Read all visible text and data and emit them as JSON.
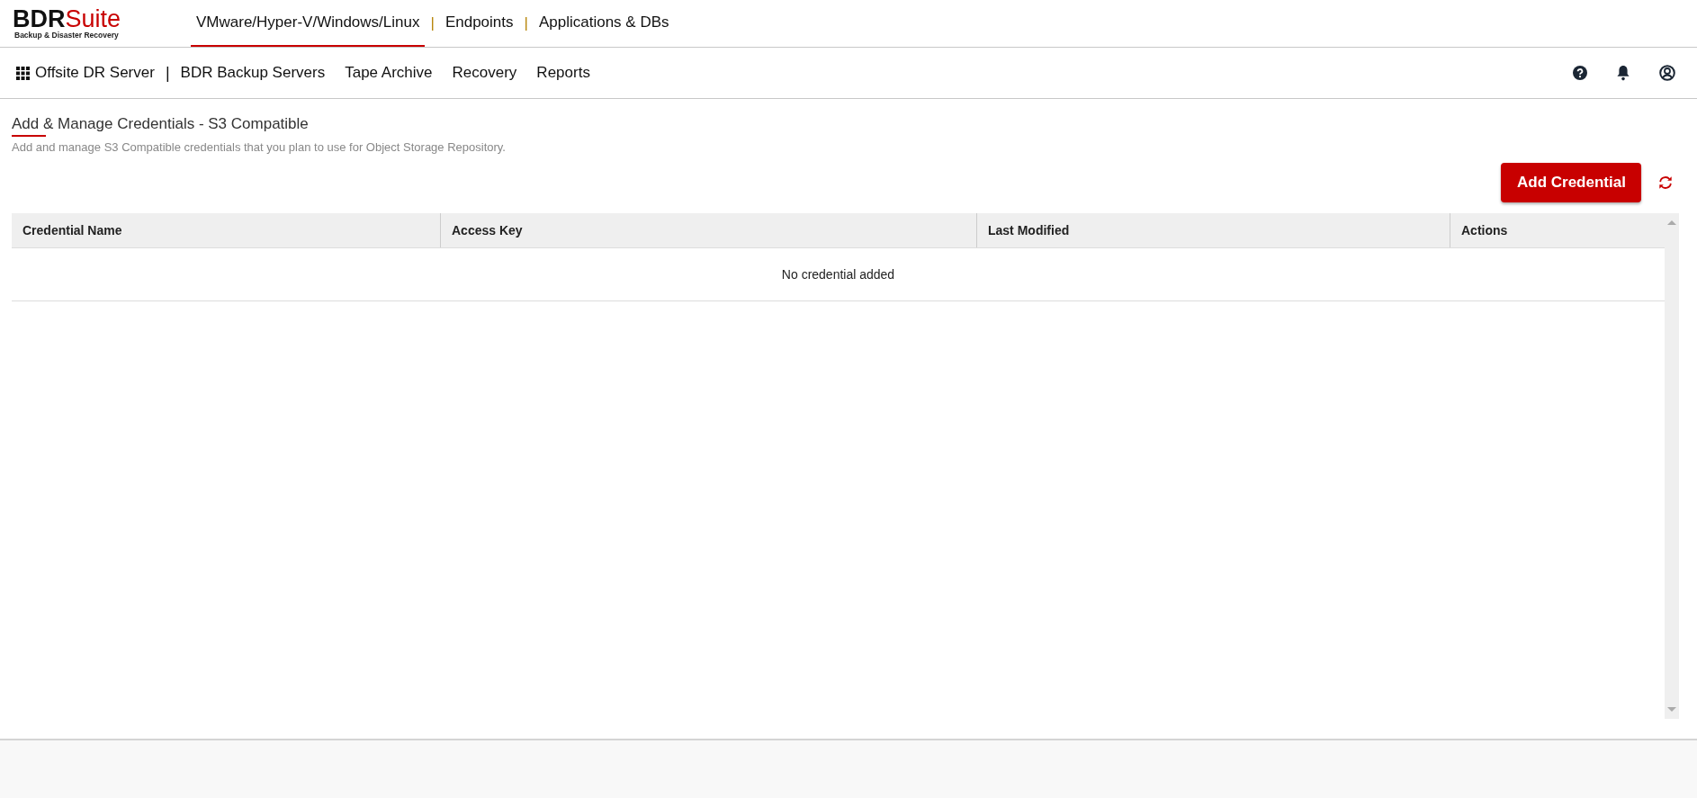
{
  "logo": {
    "brand": "BDR",
    "brand_accent": "Suite",
    "tagline": "Backup & Disaster Recovery"
  },
  "top_nav": [
    {
      "kind": "tab",
      "label": "VMware/Hyper-V/Windows/Linux",
      "selected": true
    },
    {
      "kind": "divider",
      "label": "|"
    },
    {
      "kind": "tab",
      "label": "Endpoints",
      "selected": false
    },
    {
      "kind": "divider",
      "label": "|"
    },
    {
      "kind": "tab",
      "label": "Applications & DBs",
      "selected": false
    }
  ],
  "sub_nav": [
    {
      "kind": "home",
      "label": "Offsite DR Server"
    },
    {
      "kind": "divider",
      "label": "|"
    },
    {
      "kind": "link",
      "label": "BDR Backup Servers"
    },
    {
      "kind": "link",
      "label": "Tape Archive"
    },
    {
      "kind": "link",
      "label": "Recovery"
    },
    {
      "kind": "link",
      "label": "Reports"
    }
  ],
  "page": {
    "title": "Add & Manage Credentials - S3 Compatible",
    "description": "Add and manage S3 Compatible credentials that you plan to use for Object Storage Repository.",
    "add_button": "Add Credential"
  },
  "table": {
    "columns": [
      "Credential Name",
      "Access Key",
      "Last Modified",
      "Actions"
    ],
    "empty_message": "No credential added"
  }
}
